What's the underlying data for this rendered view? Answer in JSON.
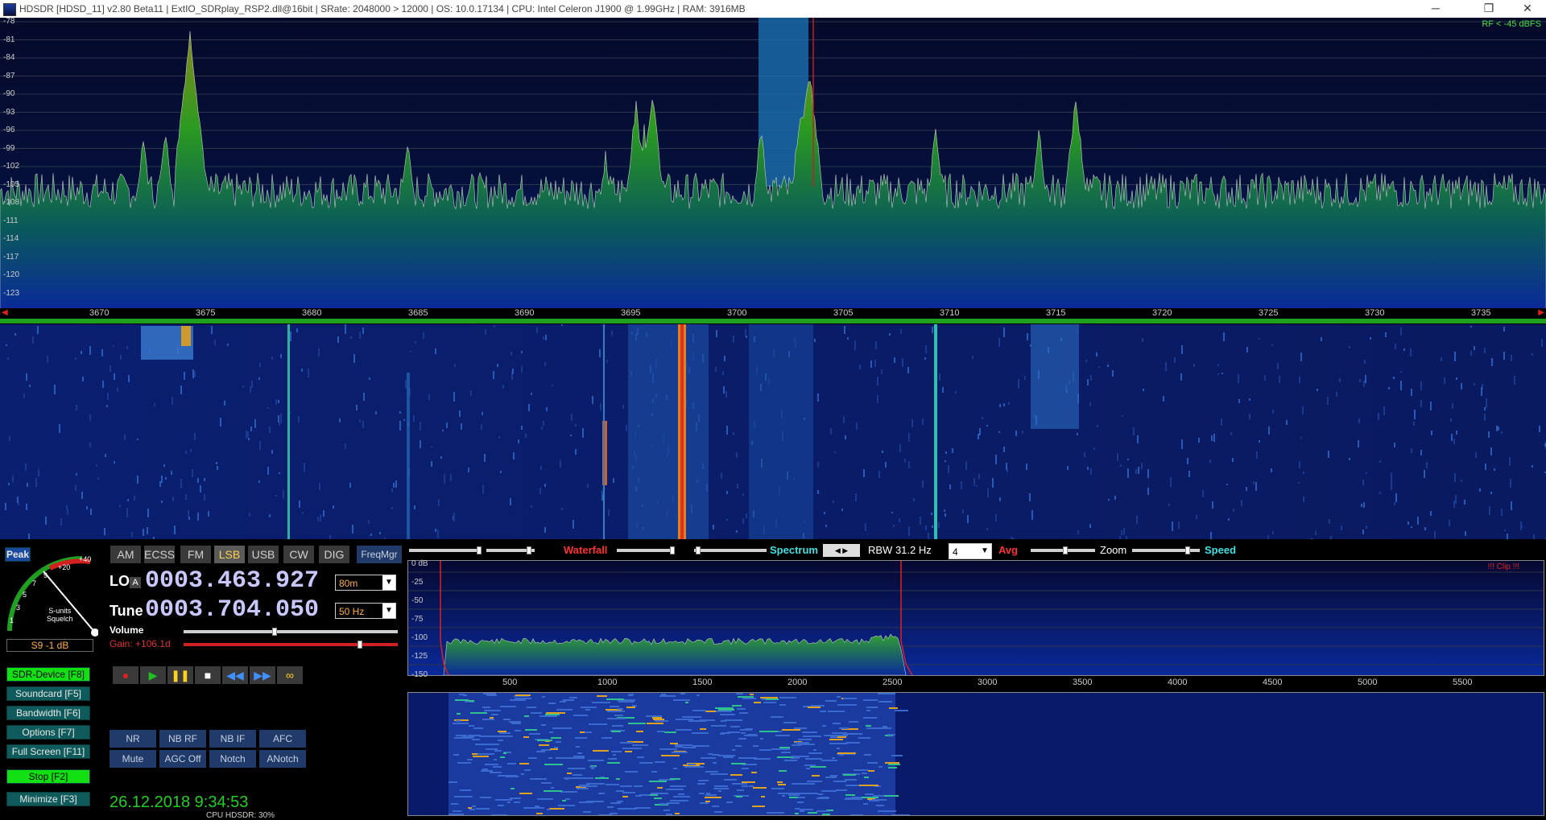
{
  "window": {
    "title": "HDSDR  [HDSD_11]  v2.80 Beta11  |  ExtIO_SDRplay_RSP2.dll@16bit  |  SRate: 2048000 > 12000  |  OS: 10.0.17134  |  CPU: Intel Celeron  J1900  @ 1.99GHz  |  RAM: 3916MB",
    "minimize": "─",
    "restore": "❐",
    "close": "✕"
  },
  "spectrum": {
    "rf_label": "RF < -45 dBFS",
    "db_ticks": [
      "-78",
      "-81",
      "-84",
      "-87",
      "-90",
      "-93",
      "-96",
      "-99",
      "-102",
      "-105",
      "-108",
      "-111",
      "-114",
      "-117",
      "-120",
      "-123"
    ],
    "freq_ticks": [
      "3670",
      "3675",
      "3680",
      "3685",
      "3690",
      "3695",
      "3700",
      "3705",
      "3710",
      "3715",
      "3720",
      "3725",
      "3730",
      "3735"
    ]
  },
  "meter": {
    "peak": "Peak",
    "scale_labels": [
      "1",
      "3",
      "5",
      "7",
      "9",
      "+20",
      "+40"
    ],
    "squelch": "S-units\nSquelch",
    "reading": "S9 -1 dB"
  },
  "modes": [
    "AM",
    "ECSS",
    "FM",
    "LSB",
    "USB",
    "CW",
    "DIG"
  ],
  "active_mode": "LSB",
  "freqmgr": "FreqMgr",
  "lo": {
    "label": "LO",
    "badge": "A",
    "value": "0003.463.927",
    "band": "80m"
  },
  "tune": {
    "label": "Tune",
    "value": "0003.704.050",
    "step": "50 Hz"
  },
  "volume": {
    "label": "Volume"
  },
  "gain": {
    "label": "Gain: +106.1d"
  },
  "side_buttons": [
    {
      "label": "SDR-Device  [F8]",
      "on": true
    },
    {
      "label": "Soundcard  [F5]",
      "on": false
    },
    {
      "label": "Bandwidth  [F6]",
      "on": false
    },
    {
      "label": "Options  [F7]",
      "on": false
    },
    {
      "label": "Full Screen  [F11]",
      "on": false
    },
    {
      "label": "Stop        [F2]",
      "on": true
    },
    {
      "label": "Minimize  [F3]",
      "on": false
    }
  ],
  "dsp_row1": [
    "NR",
    "NB RF",
    "NB IF",
    "AFC"
  ],
  "dsp_row2": [
    "Mute",
    "AGC Off",
    "Notch",
    "ANotch"
  ],
  "datetime": "26.12.2018 9:34:53",
  "cpu": "CPU  HDSDR:  30%",
  "audio_header": {
    "waterfall": "Waterfall",
    "spectrum": "Spectrum",
    "rbw": "RBW 31.2 Hz",
    "avg_value": "4",
    "avg": "Avg",
    "zoom": "Zoom",
    "speed": "Speed"
  },
  "audio_spectrum": {
    "clip": "!!! Clip !!!",
    "db_ticks": [
      "0 dB",
      "-25",
      "-50",
      "-75",
      "-100",
      "-125",
      "-150"
    ],
    "hz_ticks": [
      "500",
      "1000",
      "1500",
      "2000",
      "2500",
      "3000",
      "3500",
      "4000",
      "4500",
      "5000",
      "5500"
    ]
  },
  "colors": {
    "accent_green": "#12e012",
    "waterfall_label": "#ff3030",
    "spectrum_label": "#40e0e0",
    "digits": "#c8c8ff"
  }
}
